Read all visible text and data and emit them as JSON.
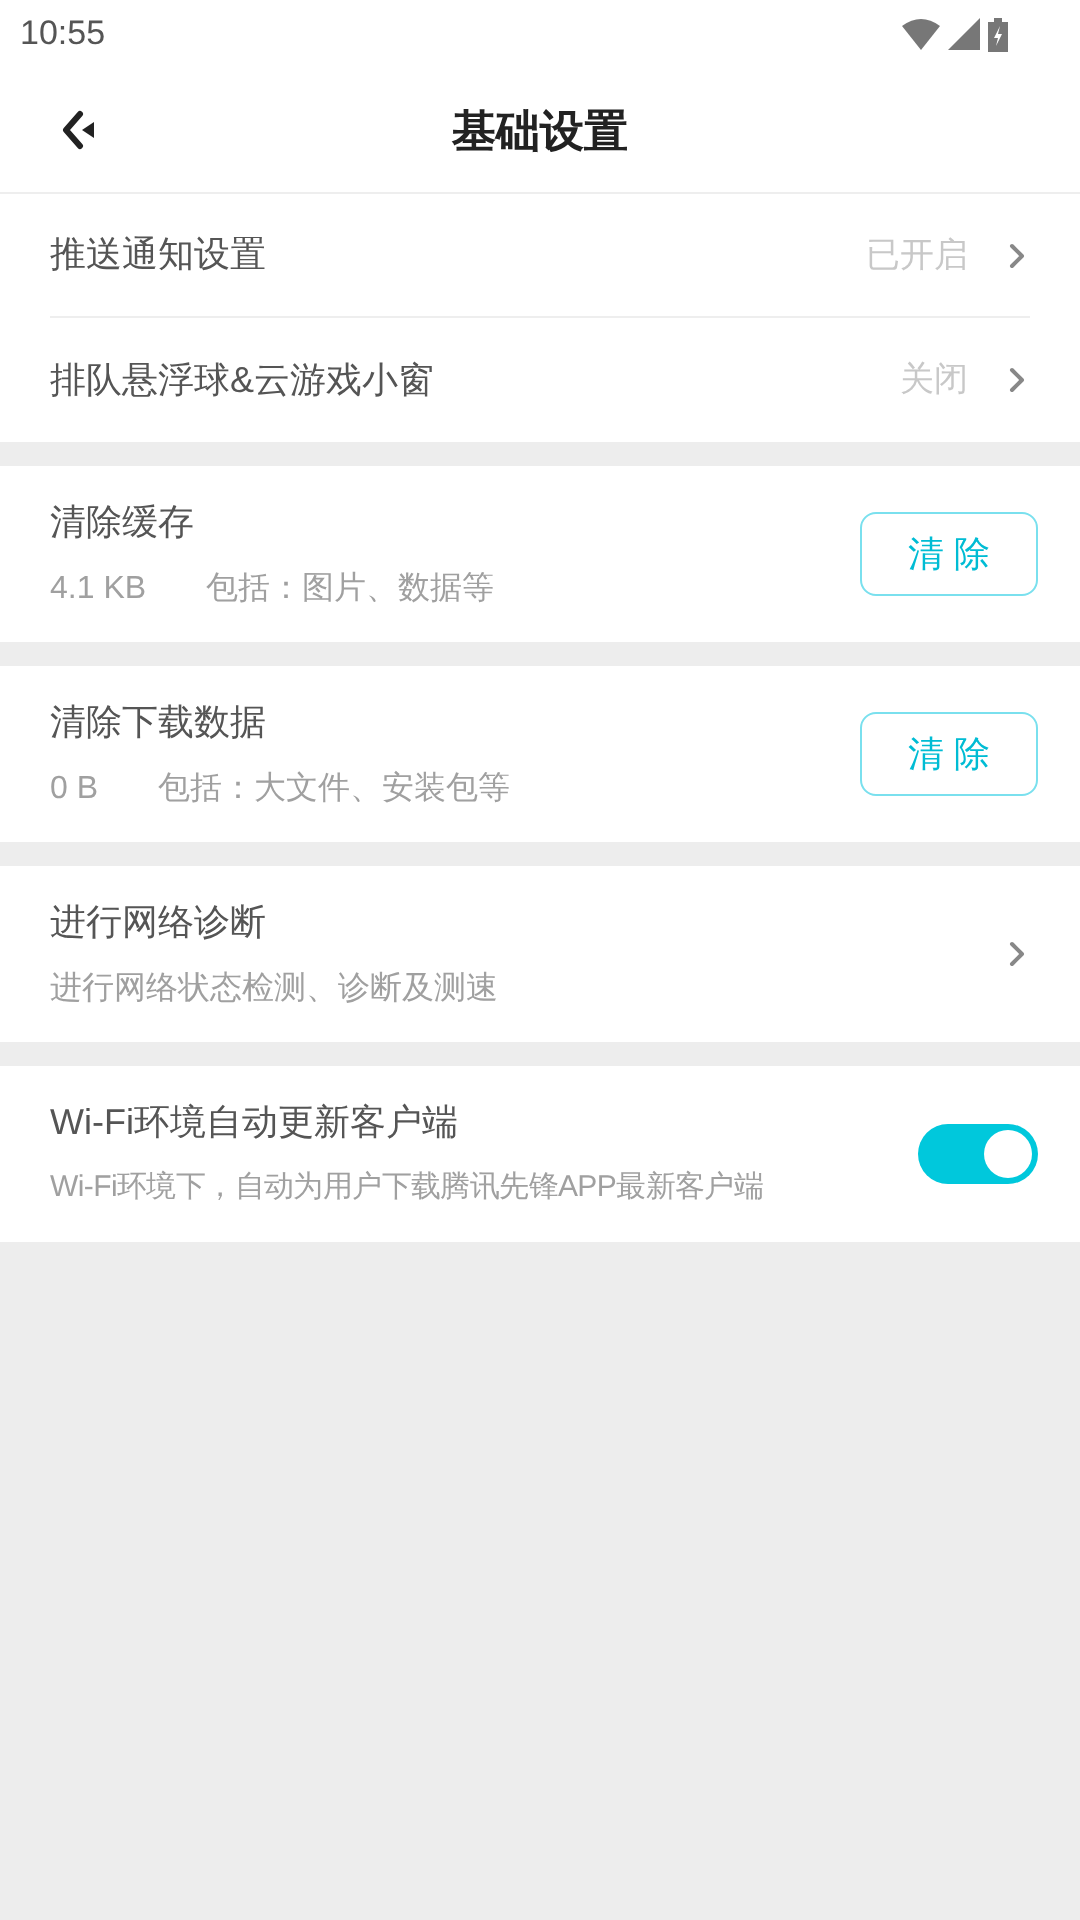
{
  "status_bar": {
    "time": "10:55"
  },
  "header": {
    "title": "基础设置"
  },
  "sections": [
    {
      "kind": "links",
      "rows": [
        {
          "title": "推送通知设置",
          "value": "已开启"
        },
        {
          "title": "排队悬浮球&云游戏小窗",
          "value": "关闭"
        }
      ]
    },
    {
      "kind": "clear",
      "title": "清除缓存",
      "size": "4.1 KB",
      "note": "包括：图片、数据等",
      "button": "清 除"
    },
    {
      "kind": "clear",
      "title": "清除下载数据",
      "size": "0 B",
      "note": "包括：大文件、安装包等",
      "button": "清 除"
    },
    {
      "kind": "link",
      "title": "进行网络诊断",
      "subtitle": "进行网络状态检测、诊断及测速"
    },
    {
      "kind": "toggle",
      "title": "Wi-Fi环境自动更新客户端",
      "subtitle": "Wi-Fi环境下，自动为用户下载腾讯先锋APP最新客户端",
      "on": true
    }
  ]
}
